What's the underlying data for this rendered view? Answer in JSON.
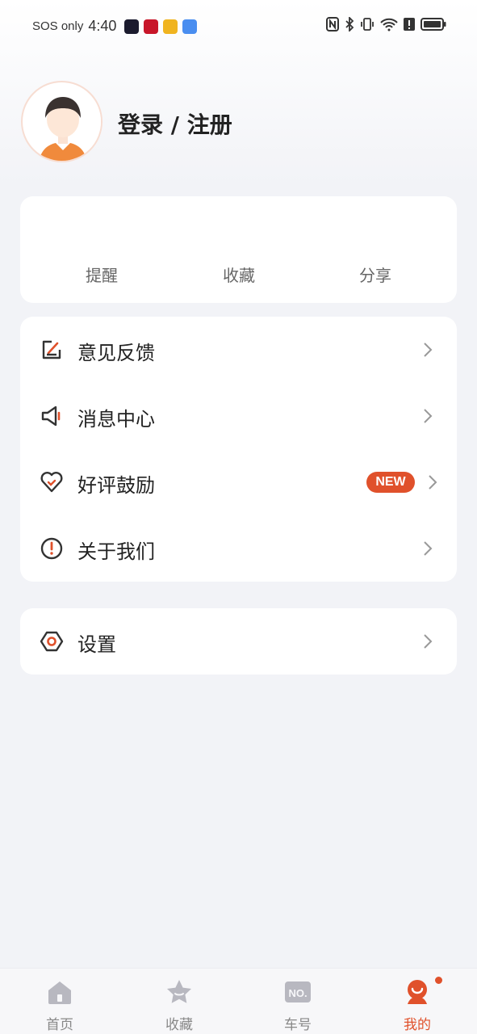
{
  "status_bar": {
    "carrier": "SOS only",
    "time": "4:40"
  },
  "profile": {
    "login_label": "登录 / 注册"
  },
  "stats": [
    {
      "label": "提醒"
    },
    {
      "label": "收藏"
    },
    {
      "label": "分享"
    }
  ],
  "menu": [
    {
      "label": "意见反馈",
      "icon": "edit-icon"
    },
    {
      "label": "消息中心",
      "icon": "speaker-icon"
    },
    {
      "label": "好评鼓励",
      "icon": "heart-icon",
      "badge": "NEW"
    },
    {
      "label": "关于我们",
      "icon": "info-icon"
    }
  ],
  "settings": {
    "label": "设置",
    "icon": "settings-icon"
  },
  "tabs": [
    {
      "label": "首页",
      "icon": "home-icon"
    },
    {
      "label": "收藏",
      "icon": "star-icon"
    },
    {
      "label": "车号",
      "icon": "number-icon"
    },
    {
      "label": "我的",
      "icon": "profile-icon",
      "active": true
    }
  ],
  "colors": {
    "accent": "#e0512b",
    "icon_dark": "#333333",
    "muted": "#888888",
    "background": "#f2f3f7"
  }
}
